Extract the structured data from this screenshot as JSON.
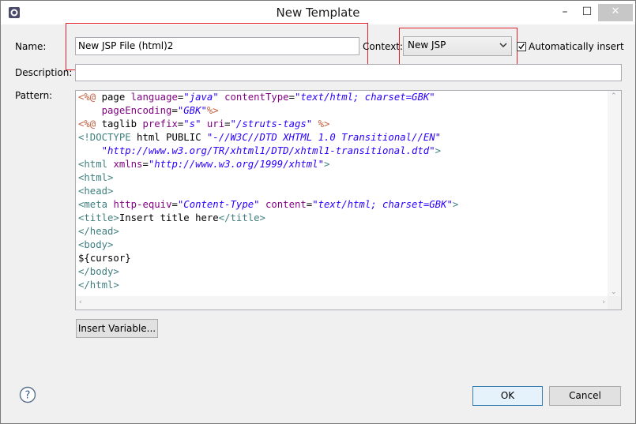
{
  "window": {
    "title": "New Template"
  },
  "titlebar_buttons": {
    "minimize": "–",
    "maximize": "☐",
    "close": "✕"
  },
  "form": {
    "name_label": "Name:",
    "name_value": "New JSP File (html)2",
    "context_label": "Context:",
    "context_value": "New JSP",
    "auto_insert_label": "Automatically insert",
    "auto_insert_checked": true,
    "description_label": "Description:",
    "description_value": "",
    "pattern_label": "Pattern:"
  },
  "pattern_lines": [
    "<%@ page language=\"java\" contentType=\"text/html; charset=GBK\"",
    "    pageEncoding=\"GBK\"%>",
    "<%@ taglib prefix=\"s\" uri=\"/struts-tags\" %>",
    "<!DOCTYPE html PUBLIC \"-//W3C//DTD XHTML 1.0 Transitional//EN\"",
    "    \"http://www.w3.org/TR/xhtml1/DTD/xhtml1-transitional.dtd\">",
    "<html xmlns=\"http://www.w3.org/1999/xhtml\">",
    "<html>",
    "<head>",
    "<meta http-equiv=\"Content-Type\" content=\"text/html; charset=GBK\">",
    "<title>Insert title here</title>",
    "</head>",
    "<body>",
    "${cursor}",
    "</body>",
    "</html>"
  ],
  "buttons": {
    "insert_variable": "Insert Variable...",
    "ok": "OK",
    "cancel": "Cancel",
    "help": "?"
  },
  "colors": {
    "highlight_border": "#e0202a",
    "jsp_tag": "#bf5f3f",
    "html_tag": "#3f7f7f",
    "attribute": "#7f007f",
    "string": "#2a00ff"
  }
}
